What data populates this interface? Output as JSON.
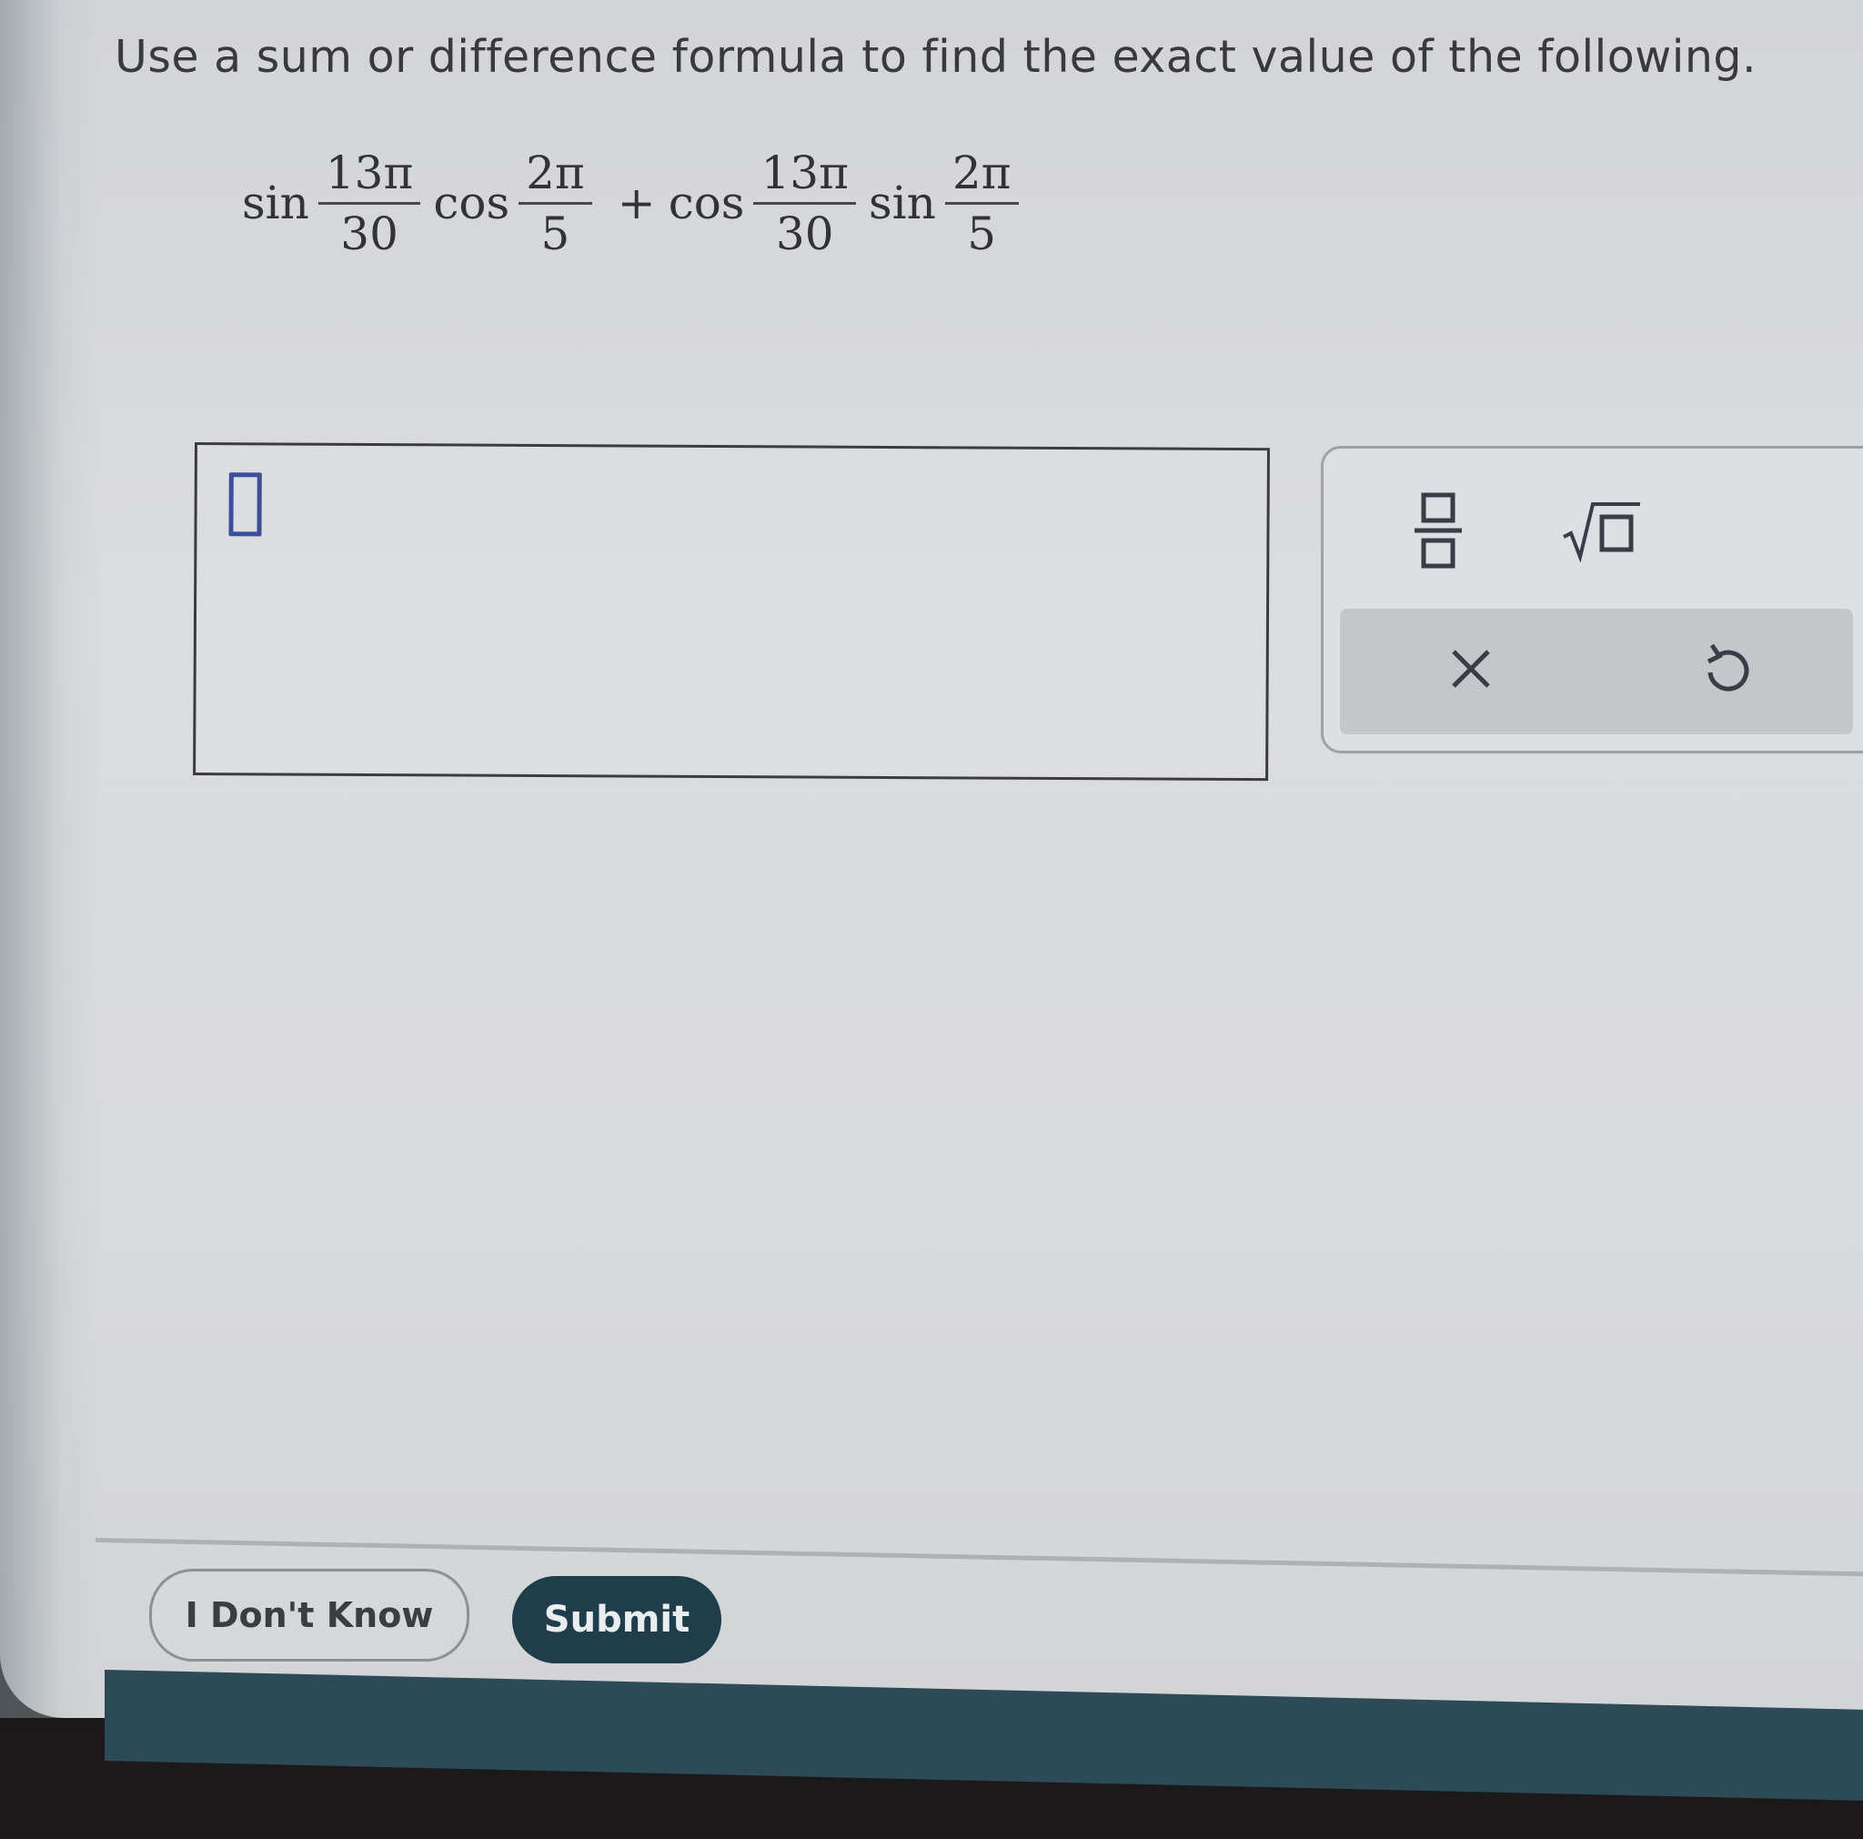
{
  "question": {
    "instruction": "Use a sum or difference formula to find the exact value of the following."
  },
  "expression": {
    "term1_fn": "sin",
    "term1_num": "13π",
    "term1_den": "30",
    "term2_fn": "cos",
    "term2_num": "2π",
    "term2_den": "5",
    "plus": "+",
    "term3_fn": "cos",
    "term3_num": "13π",
    "term3_den": "30",
    "term4_fn": "sin",
    "term4_num": "2π",
    "term4_den": "5"
  },
  "answer": {
    "value": ""
  },
  "toolbar": {
    "fraction_icon": "fraction-template-icon",
    "sqrt_icon": "square-root-template-icon",
    "clear_icon": "clear-x-icon",
    "undo_icon": "undo-icon"
  },
  "actions": {
    "dont_know_label": "I Don't Know",
    "submit_label": "Submit"
  },
  "colors": {
    "submit_bg": "#1f3d4a",
    "cursor_blue": "#3b4f9c"
  }
}
